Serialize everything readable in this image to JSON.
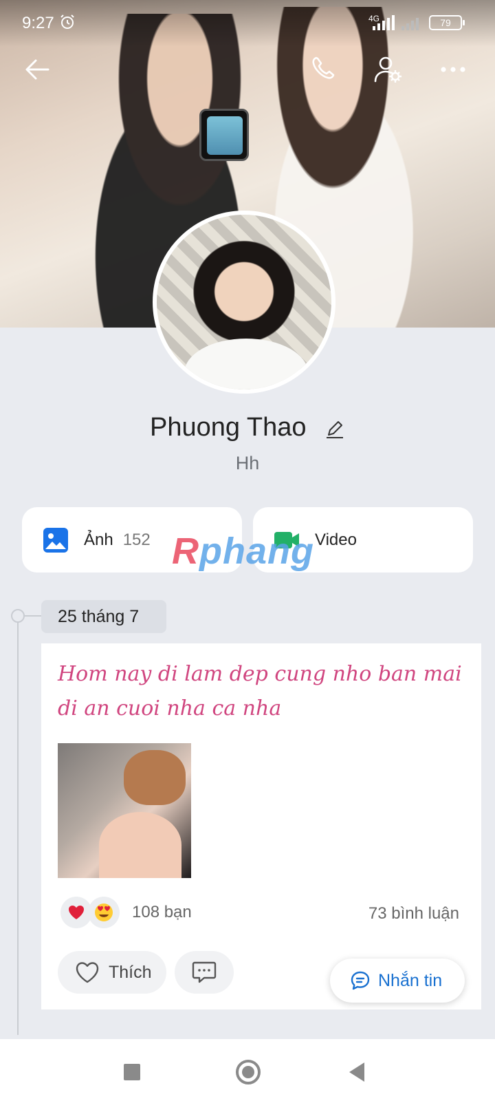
{
  "status_bar": {
    "time": "9:27",
    "network": "4G",
    "battery": "79"
  },
  "header_icons": [
    "back-arrow-icon",
    "phone-icon",
    "user-settings-icon",
    "more-icon"
  ],
  "profile": {
    "name": "Phuong Thao",
    "bio": "Hh"
  },
  "media_tiles": {
    "photos_label": "Ảnh",
    "photos_count": "152",
    "videos_label": "Video"
  },
  "watermark": "Rphang",
  "timeline": {
    "date": "25 tháng 7"
  },
  "post": {
    "text": "Hom nay di lam dep cung nho ban mai di an cuoi nha ca nha",
    "reactions": [
      "heart",
      "heart-eyes"
    ],
    "likes_text": "108 bạn",
    "comments_text": "73 bình luận",
    "like_label": "Thích"
  },
  "message_button": {
    "label": "Nhắn tin"
  },
  "colors": {
    "accent_blue": "#1870d0",
    "post_text_pink": "#d0457f",
    "background": "#e9ebf0"
  }
}
